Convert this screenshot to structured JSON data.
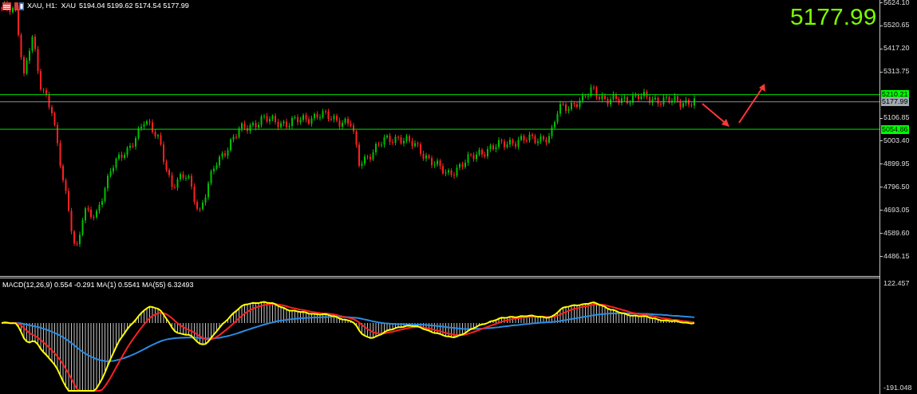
{
  "header": {
    "symbol": "XAU, H1:  XAU",
    "ohlc": "5194.04 5199.62 5174.54 5177.99"
  },
  "last_price": "5177.99",
  "price_axis": {
    "ticks": [
      "5624.10",
      "5520.65",
      "5417.20",
      "5313.75",
      "5106.85",
      "5003.40",
      "4899.95",
      "4796.50",
      "4693.05",
      "4589.60",
      "4486.15"
    ]
  },
  "levels": [
    {
      "label": "5210.21",
      "kind": "level"
    },
    {
      "label": "5177.99",
      "kind": "bid"
    },
    {
      "label": "5054.86",
      "kind": "level"
    }
  ],
  "macd": {
    "title": "MACD(12,26,9) 0.554 -0.291 MA(1) 0.5541 MA(55) 6.32493",
    "axis_max": "122.457",
    "axis_min": "-191.048"
  }
}
